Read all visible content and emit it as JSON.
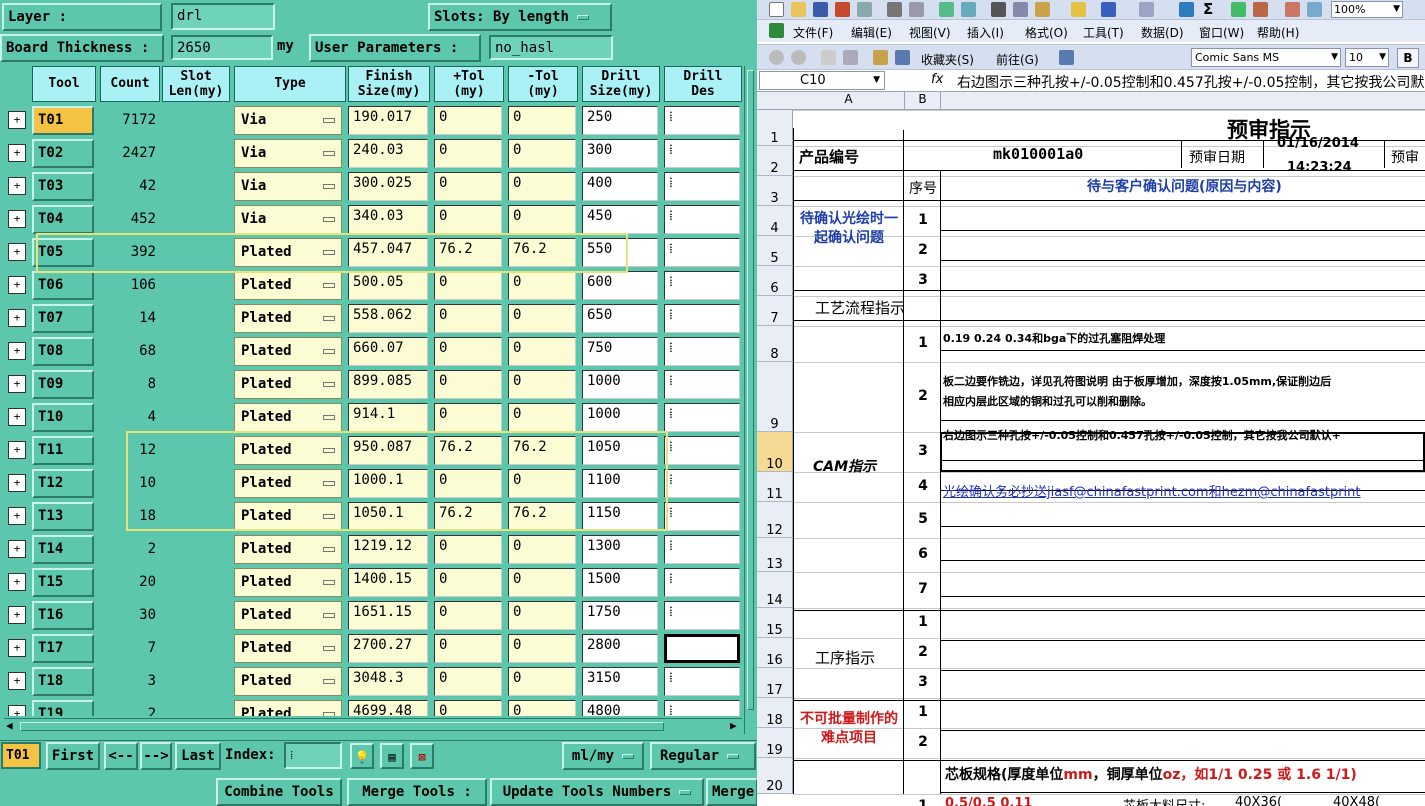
{
  "left": {
    "layer_label": "Layer :",
    "layer_value": "drl",
    "slots_label": "Slots:",
    "slots_value": "By length",
    "board_thickness_label": "Board Thickness :",
    "board_thickness_value": "2650",
    "board_thickness_unit": "my",
    "user_params_label": "User Parameters :",
    "user_params_value": "no_hasl",
    "columns": [
      "Tool",
      "Count",
      "Slot\nLen(my)",
      "Type",
      "Finish\nSize(my)",
      "+Tol\n(my)",
      "-Tol\n(my)",
      "Drill\nSize(my)",
      "Drill\nDes"
    ],
    "rows": [
      {
        "tool": "T01",
        "count": "7172",
        "type": "Via",
        "finish": "190.017",
        "ptol": "0",
        "mtol": "0",
        "drill": "250"
      },
      {
        "tool": "T02",
        "count": "2427",
        "type": "Via",
        "finish": "240.03",
        "ptol": "0",
        "mtol": "0",
        "drill": "300"
      },
      {
        "tool": "T03",
        "count": "42",
        "type": "Via",
        "finish": "300.025",
        "ptol": "0",
        "mtol": "0",
        "drill": "400"
      },
      {
        "tool": "T04",
        "count": "452",
        "type": "Via",
        "finish": "340.03",
        "ptol": "0",
        "mtol": "0",
        "drill": "450"
      },
      {
        "tool": "T05",
        "count": "392",
        "type": "Plated",
        "finish": "457.047",
        "ptol": "76.2",
        "mtol": "76.2",
        "drill": "550"
      },
      {
        "tool": "T06",
        "count": "106",
        "type": "Plated",
        "finish": "500.05",
        "ptol": "0",
        "mtol": "0",
        "drill": "600"
      },
      {
        "tool": "T07",
        "count": "14",
        "type": "Plated",
        "finish": "558.062",
        "ptol": "0",
        "mtol": "0",
        "drill": "650"
      },
      {
        "tool": "T08",
        "count": "68",
        "type": "Plated",
        "finish": "660.07",
        "ptol": "0",
        "mtol": "0",
        "drill": "750"
      },
      {
        "tool": "T09",
        "count": "8",
        "type": "Plated",
        "finish": "899.085",
        "ptol": "0",
        "mtol": "0",
        "drill": "1000"
      },
      {
        "tool": "T10",
        "count": "4",
        "type": "Plated",
        "finish": "914.1",
        "ptol": "0",
        "mtol": "0",
        "drill": "1000"
      },
      {
        "tool": "T11",
        "count": "12",
        "type": "Plated",
        "finish": "950.087",
        "ptol": "76.2",
        "mtol": "76.2",
        "drill": "1050"
      },
      {
        "tool": "T12",
        "count": "10",
        "type": "Plated",
        "finish": "1000.1",
        "ptol": "0",
        "mtol": "0",
        "drill": "1100"
      },
      {
        "tool": "T13",
        "count": "18",
        "type": "Plated",
        "finish": "1050.1",
        "ptol": "76.2",
        "mtol": "76.2",
        "drill": "1150"
      },
      {
        "tool": "T14",
        "count": "2",
        "type": "Plated",
        "finish": "1219.12",
        "ptol": "0",
        "mtol": "0",
        "drill": "1300"
      },
      {
        "tool": "T15",
        "count": "20",
        "type": "Plated",
        "finish": "1400.15",
        "ptol": "0",
        "mtol": "0",
        "drill": "1500"
      },
      {
        "tool": "T16",
        "count": "30",
        "type": "Plated",
        "finish": "1651.15",
        "ptol": "0",
        "mtol": "0",
        "drill": "1750"
      },
      {
        "tool": "T17",
        "count": "7",
        "type": "Plated",
        "finish": "2700.27",
        "ptol": "0",
        "mtol": "0",
        "drill": "2800"
      },
      {
        "tool": "T18",
        "count": "3",
        "type": "Plated",
        "finish": "3048.3",
        "ptol": "0",
        "mtol": "0",
        "drill": "3150"
      },
      {
        "tool": "T19",
        "count": "2",
        "type": "Plated",
        "finish": "4699.48",
        "ptol": "0",
        "mtol": "0",
        "drill": "4800"
      }
    ],
    "bottom": {
      "current_tool": "T01",
      "first": "First",
      "prev": "<--",
      "next": "-->",
      "last": "Last",
      "index_label": "Index:",
      "units": "ml/my",
      "mode": "Regular",
      "combine": "Combine Tools",
      "merge": "Merge Tools :",
      "update": "Update Tools Numbers",
      "merge2": "Merge"
    }
  },
  "right": {
    "zoom": "100%",
    "menu": [
      "文件(F)",
      "编辑(E)",
      "视图(V)",
      "插入(I)",
      "格式(O)",
      "工具(T)",
      "数据(D)",
      "窗口(W)",
      "帮助(H)"
    ],
    "favorites": "收藏夹(S)",
    "goto": "前往(G)",
    "font_name": "Comic Sans MS",
    "font_size": "10",
    "bold": "B",
    "cell_ref": "C10",
    "fx": "fx",
    "formula": "右边图示三种孔按+/-0.05控制和0.457孔按+/-0.05控制，其它按我公司默认",
    "col_a": "A",
    "col_b": "B",
    "title": "预审指示",
    "product_label": "产品编号",
    "product_value": "mk010001a0",
    "review_date_label": "预审日期",
    "review_date_value": "01/16/2014",
    "review_time_value": "14:23:24",
    "review_extra": "预审",
    "seq_label": "序号",
    "confirm_header": "待与客户确认问题(原因与内容)",
    "confirm_section": "待确认光绘时一起确认问题",
    "process_section": "工艺流程指示",
    "cam_section": "CAM指示",
    "cam_1": "0.19 0.24 0.34和bga下的过孔塞阻焊处理",
    "cam_2a": "板二边要作铣边，详见孔符图说明 由于板厚增加，深度按1.05mm,保证削边后",
    "cam_2b": "相应内层此区域的铜和过孔可以削和删除。",
    "cam_3": "右边图示三种孔按+/-0.05控制和0.457孔按+/-0.05控制，其它按我公司默认+",
    "cam_4": "光绘确认务必抄送jiasf@chinafastprint.com和hezm@chinafastprint",
    "step_section": "工序指示",
    "difficulty_section": "不可批量制作的难点项目",
    "core_label_a": "芯板规格(厚度单位",
    "core_mm": "mm",
    "core_label_b": "，铜厚单位",
    "core_oz": "oz",
    "core_label_c": "，如1/1 0.25 或 1.6 1/1)",
    "row21_value": "0.5/0.5 0.11",
    "row21_label": "芯板大料尺寸:",
    "row21_opt1": "40X36(",
    "row21_opt2": "40X48(",
    "row_numbers": [
      "1",
      "2",
      "3",
      "4",
      "5",
      "6",
      "7",
      "8",
      "9",
      "10",
      "11",
      "12",
      "13",
      "14",
      "15",
      "16",
      "17",
      "18",
      "19",
      "20"
    ],
    "seq_confirm": [
      "1",
      "2",
      "3"
    ],
    "seq_cam": [
      "1",
      "2",
      "3",
      "4",
      "5",
      "6",
      "7"
    ],
    "seq_step": [
      "1",
      "2",
      "3"
    ],
    "seq_diff": [
      "1",
      "2"
    ],
    "seq_last": "1"
  }
}
